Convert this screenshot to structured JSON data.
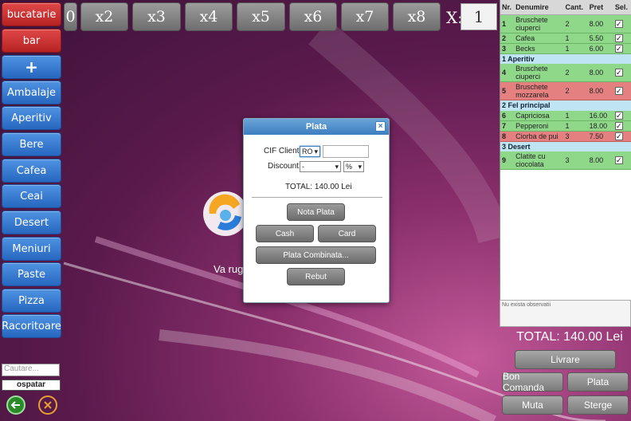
{
  "categories": [
    {
      "label": "bucatarie",
      "color": "red"
    },
    {
      "label": "bar",
      "color": "red"
    },
    {
      "label": "+",
      "color": "blue"
    },
    {
      "label": "Ambalaje",
      "color": "blue"
    },
    {
      "label": "Aperitiv",
      "color": "blue"
    },
    {
      "label": "Bere",
      "color": "blue"
    },
    {
      "label": "Cafea",
      "color": "blue"
    },
    {
      "label": "Ceai",
      "color": "blue"
    },
    {
      "label": "Desert",
      "color": "blue"
    },
    {
      "label": "Meniuri",
      "color": "blue"
    },
    {
      "label": "Paste",
      "color": "blue"
    },
    {
      "label": "Pizza",
      "color": "blue"
    },
    {
      "label": "Racoritoare",
      "color": "blue"
    }
  ],
  "multipliers": [
    "0",
    "x2",
    "x3",
    "x4",
    "x5",
    "x6",
    "x7",
    "x8"
  ],
  "multiplier_label": "X:",
  "multiplier_value": "1",
  "order": {
    "headers": {
      "nr": "Nr.",
      "name": "Denumire",
      "qty": "Cant.",
      "price": "Pret",
      "sel": "Sel."
    },
    "groups": [
      {
        "title": "",
        "rows": [
          {
            "nr": "1",
            "name": "Bruschete ciuperci",
            "qty": "2",
            "price": "8.00",
            "status": "green"
          },
          {
            "nr": "2",
            "name": "Cafea",
            "qty": "1",
            "price": "5.50",
            "status": "green"
          },
          {
            "nr": "3",
            "name": "Becks",
            "qty": "1",
            "price": "6.00",
            "status": "green"
          }
        ]
      },
      {
        "title": "1 Aperitiv",
        "rows": [
          {
            "nr": "4",
            "name": "Bruschete ciuperci",
            "qty": "2",
            "price": "8.00",
            "status": "green"
          },
          {
            "nr": "5",
            "name": "Bruschete mozzarela",
            "qty": "2",
            "price": "8.00",
            "status": "red"
          }
        ]
      },
      {
        "title": "2 Fel principal",
        "rows": [
          {
            "nr": "6",
            "name": "Capriciosa",
            "qty": "1",
            "price": "16.00",
            "status": "green"
          },
          {
            "nr": "7",
            "name": "Pepperoni",
            "qty": "1",
            "price": "18.00",
            "status": "green"
          },
          {
            "nr": "8",
            "name": "Ciorba de pui",
            "qty": "3",
            "price": "7.50",
            "status": "red"
          }
        ]
      },
      {
        "title": "3 Desert",
        "rows": [
          {
            "nr": "9",
            "name": "Clatite cu ciocolata",
            "qty": "3",
            "price": "8.00",
            "status": "green"
          }
        ]
      }
    ],
    "observations_placeholder": "Nu exista observatii",
    "total": "TOTAL: 140.00 Lei"
  },
  "actions": {
    "livrare": "Livrare",
    "bon_comanda": "Bon Comanda",
    "plata": "Plata",
    "muta": "Muta",
    "sterge": "Sterge"
  },
  "search_placeholder": "Cautare...",
  "waiter": "ospatar",
  "loading_text": "Va rug",
  "dialog": {
    "title": "Plata",
    "cif_label": "CIF Client:",
    "cif_prefix": "RO",
    "discount_label": "Discount:",
    "discount_value": "-",
    "discount_unit": "%",
    "total": "TOTAL: 140.00 Lei",
    "nota_plata": "Nota Plata",
    "cash": "Cash",
    "card": "Card",
    "plata_combinata": "Plata Combinata...",
    "rebut": "Rebut"
  },
  "colors": {
    "green_row": "#8fd88a",
    "red_row": "#e58080",
    "group_row": "#bfe4f2",
    "blue_button": "#2767c0",
    "red_button": "#b62222"
  }
}
